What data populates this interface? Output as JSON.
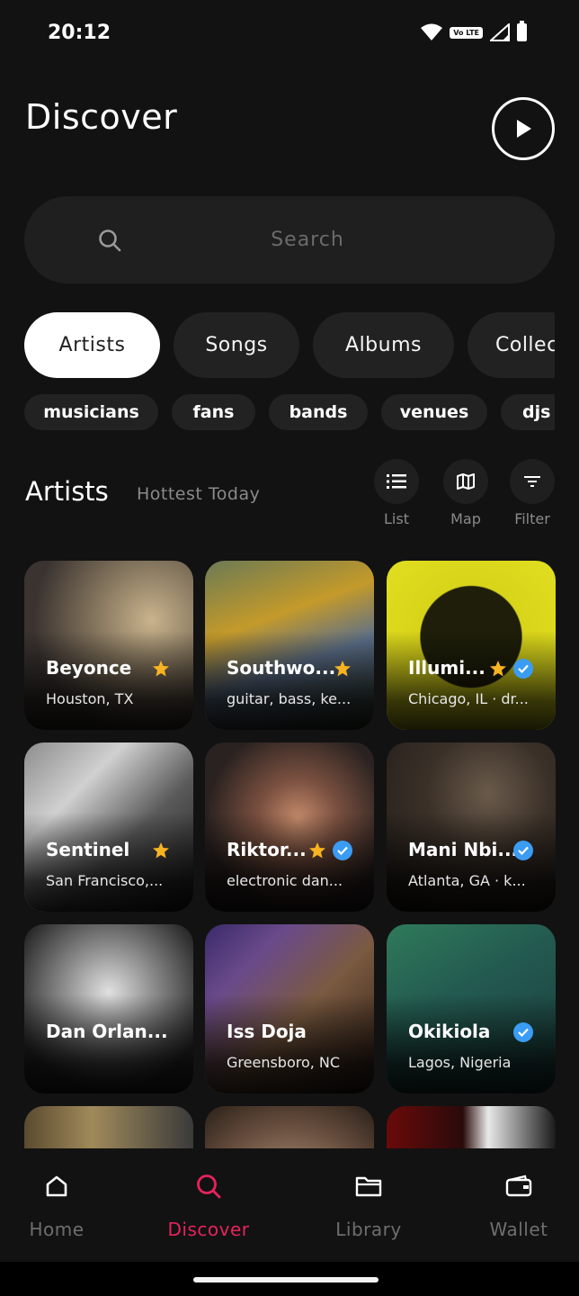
{
  "status": {
    "time": "20:12",
    "volte": "Vo LTE"
  },
  "header": {
    "title": "Discover"
  },
  "search": {
    "placeholder": "Search"
  },
  "tabs": [
    {
      "label": "Artists",
      "active": true
    },
    {
      "label": "Songs"
    },
    {
      "label": "Albums"
    },
    {
      "label": "Collec"
    }
  ],
  "chips": [
    "musicians",
    "fans",
    "bands",
    "venues",
    "djs"
  ],
  "section": {
    "title": "Artists",
    "subtitle": "Hottest Today",
    "views": {
      "list": "List",
      "map": "Map",
      "filter": "Filter"
    }
  },
  "artists": [
    {
      "name": "Beyonce",
      "sub": "Houston, TX",
      "starred": true,
      "verified": false
    },
    {
      "name": "Southwo...",
      "sub": "guitar, bass, ke...",
      "starred": true,
      "verified": false
    },
    {
      "name": "Illumi...",
      "sub": "Chicago, IL · dr...",
      "starred": true,
      "verified": true
    },
    {
      "name": "Sentinel",
      "sub": "San Francisco,...",
      "starred": true,
      "verified": false
    },
    {
      "name": "Riktor...",
      "sub": "electronic dan...",
      "starred": true,
      "verified": true
    },
    {
      "name": "Mani Nbi...",
      "sub": "Atlanta, GA · k...",
      "starred": false,
      "verified": true
    },
    {
      "name": "Dan  Orlan...",
      "sub": "",
      "starred": false,
      "verified": false
    },
    {
      "name": "Iss Doja",
      "sub": "Greensboro, NC",
      "starred": false,
      "verified": false
    },
    {
      "name": "Okikiola",
      "sub": "Lagos, Nigeria",
      "starred": false,
      "verified": true
    }
  ],
  "nav": {
    "home": "Home",
    "discover": "Discover",
    "library": "Library",
    "wallet": "Wallet",
    "active": "discover",
    "active_color": "#e8225c"
  }
}
